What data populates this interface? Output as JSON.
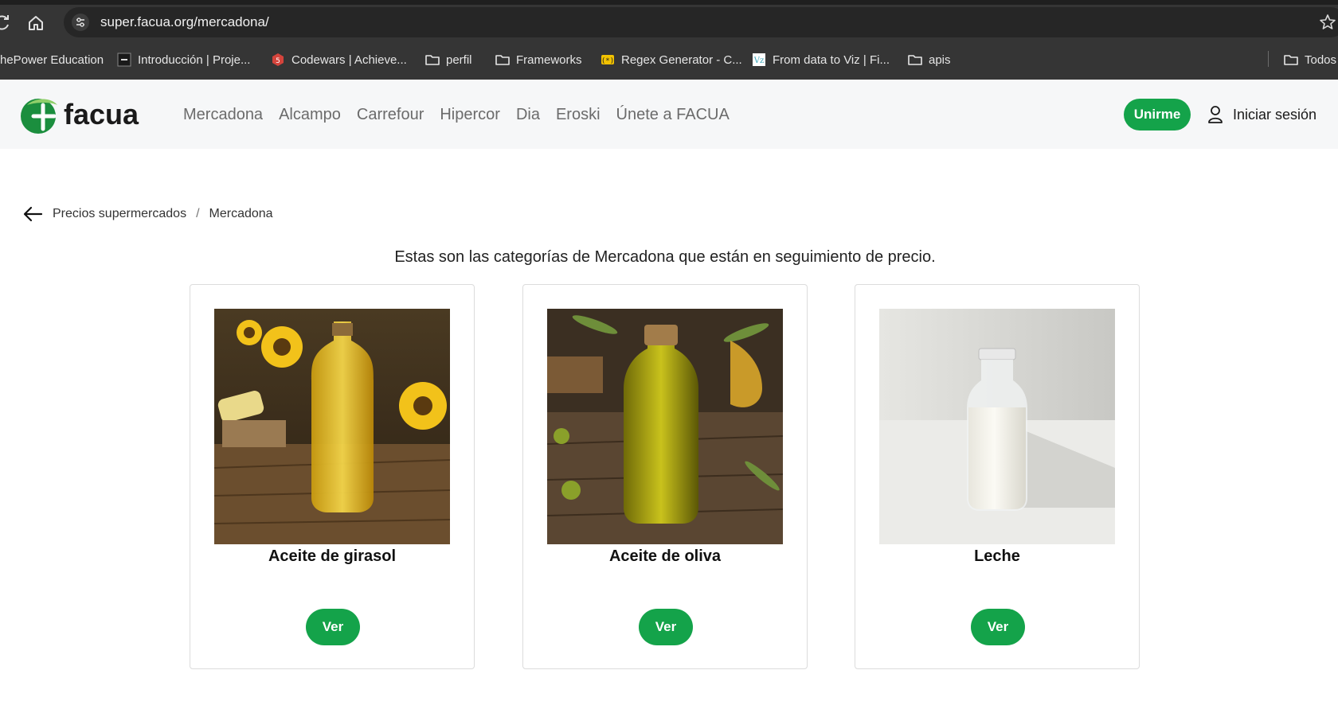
{
  "browser": {
    "url": "super.facua.org/mercadona/",
    "bookmarks": [
      {
        "label": "hePower Education",
        "icon": "none"
      },
      {
        "label": "Introducción | Proje...",
        "icon": "page-icon"
      },
      {
        "label": "Codewars | Achieve...",
        "icon": "codewars-icon"
      },
      {
        "label": "perfil",
        "icon": "folder-icon"
      },
      {
        "label": "Frameworks",
        "icon": "folder-icon"
      },
      {
        "label": "Regex Generator - C...",
        "icon": "regex-icon"
      },
      {
        "label": "From data to Viz | Fi...",
        "icon": "viz-icon"
      },
      {
        "label": "apis",
        "icon": "folder-icon"
      },
      {
        "label": "Todos",
        "icon": "folder-icon"
      }
    ]
  },
  "header": {
    "logo_text": "facua",
    "nav": [
      "Mercadona",
      "Alcampo",
      "Carrefour",
      "Hipercor",
      "Dia",
      "Eroski",
      "Únete a FACUA"
    ],
    "join_label": "Unirme",
    "login_label": "Iniciar sesión"
  },
  "breadcrumb": {
    "parent": "Precios supermercados",
    "separator": "/",
    "current": "Mercadona"
  },
  "intro": "Estas son las categorías de Mercadona que están en seguimiento de precio.",
  "categories": [
    {
      "title": "Aceite de girasol",
      "button": "Ver"
    },
    {
      "title": "Aceite de oliva",
      "button": "Ver"
    },
    {
      "title": "Leche",
      "button": "Ver"
    }
  ],
  "colors": {
    "brand_green": "#14a34a",
    "header_bg": "#f6f7f8",
    "chrome_bg": "#353535"
  }
}
